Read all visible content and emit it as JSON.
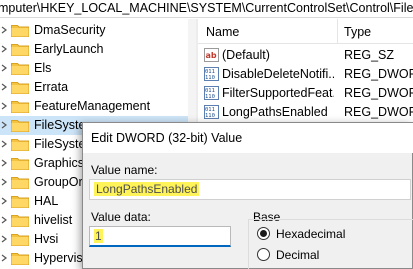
{
  "address_bar": {
    "path": "mputer\\HKEY_LOCAL_MACHINE\\SYSTEM\\CurrentControlSet\\Control\\FileSyst"
  },
  "tree": {
    "items": [
      {
        "label": "DmaSecurity",
        "selected": false
      },
      {
        "label": "EarlyLaunch",
        "selected": false
      },
      {
        "label": "Els",
        "selected": false
      },
      {
        "label": "Errata",
        "selected": false
      },
      {
        "label": "FeatureManagement",
        "selected": false
      },
      {
        "label": "FileSystem",
        "selected": true
      },
      {
        "label": "FileSystem",
        "selected": false
      },
      {
        "label": "GraphicsD",
        "selected": false
      },
      {
        "label": "GroupOrd",
        "selected": false
      },
      {
        "label": "HAL",
        "selected": false
      },
      {
        "label": "hivelist",
        "selected": false
      },
      {
        "label": "Hvsi",
        "selected": false
      },
      {
        "label": "Hypervisor",
        "selected": false
      }
    ]
  },
  "values_list": {
    "columns": {
      "name": "Name",
      "type": "Type"
    },
    "rows": [
      {
        "name": "(Default)",
        "type": "REG_SZ",
        "icon": "string-value-icon"
      },
      {
        "name": "DisableDeleteNotifi...",
        "type": "REG_DWORD",
        "icon": "binary-value-icon"
      },
      {
        "name": "FilterSupportedFeat...",
        "type": "REG_DWORD",
        "icon": "binary-value-icon"
      },
      {
        "name": "LongPathsEnabled",
        "type": "REG_DWORD",
        "icon": "binary-value-icon"
      }
    ]
  },
  "dialog": {
    "title": "Edit DWORD (32-bit) Value",
    "value_name_label": "Value name:",
    "value_name": "LongPathsEnabled",
    "value_data_label": "Value data:",
    "value_data": "1",
    "base_label": "Base",
    "base_options": [
      {
        "label": "Hexadecimal",
        "checked": true
      },
      {
        "label": "Decimal",
        "checked": false
      }
    ]
  },
  "colors": {
    "selection": "#cce4f7",
    "folder": "#f5c342",
    "highlight": "#fff35a",
    "accent": "#0067c0"
  }
}
